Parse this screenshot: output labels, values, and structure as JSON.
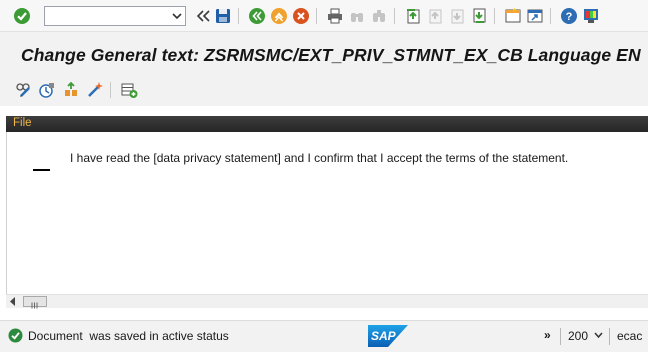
{
  "title": "Change General text: ZSRMSMC/EXT_PRIV_STMNT_EX_CB Language EN",
  "command_field": {
    "value": "",
    "placeholder": ""
  },
  "system_toolbar": [
    "enter-icon",
    "back-icon",
    "save-icon",
    "back-green-icon",
    "exit-icon",
    "cancel-icon",
    "print-icon",
    "find-icon",
    "find-next-icon",
    "first-page-icon",
    "prev-page-icon",
    "next-page-icon",
    "last-page-icon",
    "new-session-icon",
    "shortcut-icon",
    "help-icon",
    "customize-icon"
  ],
  "app_toolbar": [
    "display-change-icon",
    "activate-icon",
    "format-icon",
    "magic-wand-icon",
    "insert-icon"
  ],
  "menu": {
    "file_label": "File"
  },
  "editor": {
    "line1": "I have read the [data privacy statement] and I confirm that I accept the terms of the statement."
  },
  "statusbar": {
    "message": "Document  was saved in active status",
    "more": "»",
    "client": "200",
    "server": "ecac"
  },
  "colors": {
    "accent": "#0a6ed1",
    "status_ok": "#2b8a3e",
    "menu_text": "#f0b64b"
  }
}
